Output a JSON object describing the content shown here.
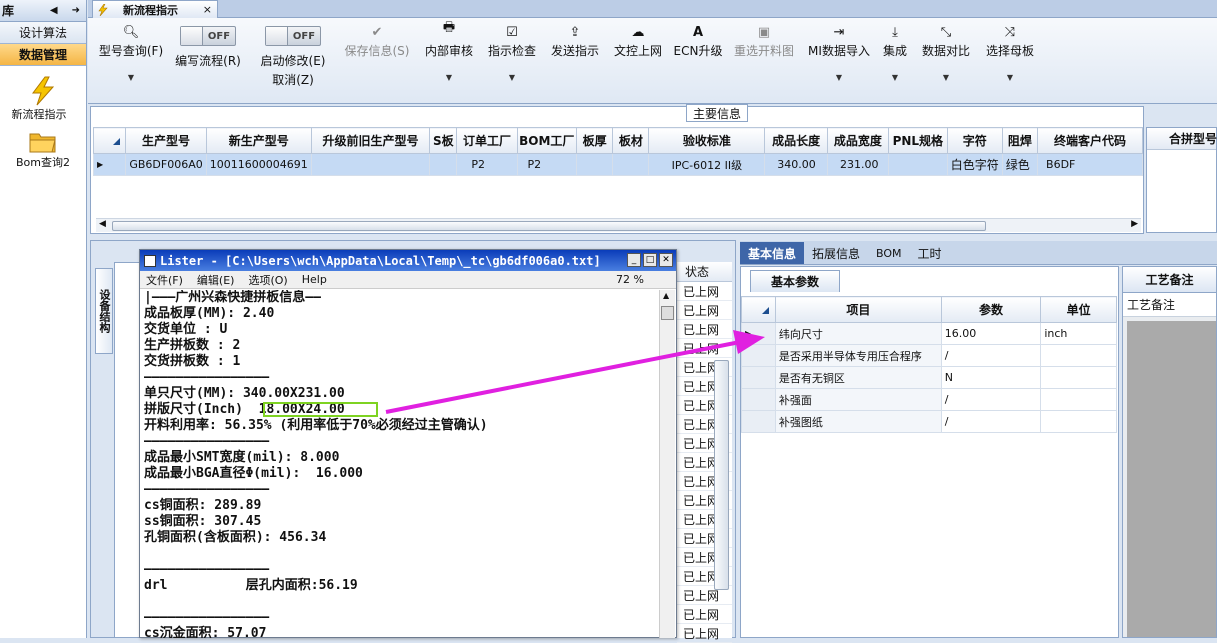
{
  "leftnav": {
    "header": "库",
    "items": [
      {
        "label": "设计算法",
        "selected": false
      },
      {
        "label": "数据管理",
        "selected": true
      }
    ],
    "icons": [
      {
        "label": "新流程指示",
        "icon": "lightning-icon"
      },
      {
        "label": "Bom查询2",
        "icon": "folder-icon"
      }
    ]
  },
  "doc_tab": {
    "title": "新流程指示",
    "close": "×"
  },
  "toolbar": {
    "items": [
      {
        "label": "型号查询(F)",
        "icon": "search-icon",
        "disabled": false,
        "dropdown": true
      },
      {
        "label": "编写流程(R)",
        "toggle": "OFF"
      },
      {
        "label": "启动修改(E)",
        "label2": "取消(Z)",
        "toggle": "OFF"
      },
      {
        "label": "保存信息(S)",
        "icon": "check-icon",
        "disabled": true
      },
      {
        "label": "内部审核",
        "icon": "print-icon",
        "dropdown": true
      },
      {
        "label": "指示检查",
        "icon": "checkbox-icon",
        "dropdown": true
      },
      {
        "label": "发送指示",
        "icon": "upload-icon"
      },
      {
        "label": "文控上网",
        "icon": "cloud-upload-icon"
      },
      {
        "label": "ECN升级",
        "icon": "font-icon"
      },
      {
        "label": "重选开料图",
        "icon": "image-icon",
        "disabled": true
      },
      {
        "label": "MI数据导入",
        "icon": "import-icon",
        "dropdown": true
      },
      {
        "label": "集成",
        "icon": "download-icon",
        "dropdown": true
      },
      {
        "label": "数据对比",
        "icon": "compress-icon",
        "dropdown": true
      },
      {
        "label": "选择母板",
        "icon": "shuffle-icon",
        "dropdown": true
      }
    ]
  },
  "main_grid": {
    "caption": "主要信息",
    "columns": [
      "生产型号",
      "新生产型号",
      "升级前旧生产型号",
      "S板",
      "订单工厂",
      "BOM工厂",
      "板厚",
      "板材",
      "验收标准",
      "成品长度",
      "成品宽度",
      "PNL规格",
      "字符",
      "阻焊",
      "终端客户代码"
    ],
    "rows": [
      [
        "GB6DF006A0",
        "10011600004691",
        "",
        "",
        "P2",
        "P2",
        "",
        "",
        "IPC-6012 II级",
        "340.00",
        "231.00",
        "",
        "白色字符",
        "绿色",
        "B6DF"
      ]
    ],
    "right_header": "合拼型号"
  },
  "lower_left": {
    "vertical_tab": "设备结构",
    "status_header": "状态",
    "status_values": [
      "已上网",
      "已上网",
      "已上网",
      "已上网",
      "已上网",
      "已上网",
      "已上网",
      "已上网",
      "已上网",
      "已上网",
      "已上网",
      "已上网",
      "已上网",
      "已上网",
      "已上网",
      "已上网",
      "已上网",
      "已上网",
      "已上网"
    ]
  },
  "lister": {
    "title": "Lister - [C:\\Users\\wch\\AppData\\Local\\Temp\\_tc\\gb6df006a0.txt]",
    "menu": [
      "文件(F)",
      "编辑(E)",
      "选项(O)",
      "Help"
    ],
    "zoom": "72 %",
    "lines": [
      "|———广州兴森快捷拼板信息——",
      "成品板厚(MM): 2.40",
      "交货单位 : U",
      "生产拼板数 : 2",
      "交货拼板数 : 1",
      "————————————————",
      "单只尺寸(MM): 340.00X231.00",
      "拼版尺寸(Inch)  18.00X24.00",
      "开料利用率: 56.35% (利用率低于70%必须经过主管确认)",
      "————————————————",
      "成品最小SMT宽度(mil): 8.000",
      "成品最小BGA直径Φ(mil):  16.000",
      "————————————————",
      "cs铜面积: 289.89",
      "ss铜面积: 307.45",
      "孔铜面积(含板面积): 456.34",
      "",
      "————————————————",
      "drl          层孔内面积:56.19",
      "",
      "————————————————",
      "cs沉金面积: 57.07"
    ]
  },
  "detail": {
    "tabs": [
      {
        "label": "基本信息",
        "selected": true
      },
      {
        "label": "拓展信息",
        "selected": false
      },
      {
        "label": "BOM",
        "selected": false
      },
      {
        "label": "工时",
        "selected": false
      }
    ],
    "sub_tab": "基本参数",
    "columns": [
      "项目",
      "参数",
      "单位"
    ],
    "rows": [
      [
        "纬向尺寸",
        "16.00",
        "inch"
      ],
      [
        "是否采用半导体专用压合程序",
        "/",
        ""
      ],
      [
        "是否有无铜区",
        "N",
        ""
      ],
      [
        "补强面",
        "/",
        ""
      ],
      [
        "补强图纸",
        "/",
        ""
      ]
    ],
    "craft_tab": "工艺备注",
    "craft_label": "工艺备注"
  },
  "colors": {
    "accent": "#3e66a8",
    "highlight_box": "#7ed321",
    "arrow": "#e020e0",
    "selected_row": "#c5daf4"
  }
}
